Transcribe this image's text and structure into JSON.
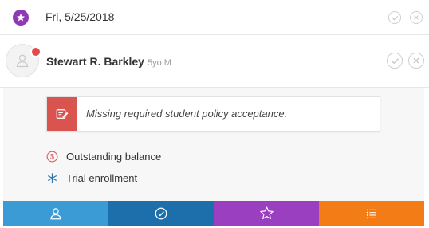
{
  "header": {
    "date": "Fri, 5/25/2018",
    "badge_icon": "star-icon",
    "badge_color": "#8e3ab4"
  },
  "student": {
    "name": "Stewart R. Barkley",
    "age": "5yo M",
    "avatar_icon": "user-icon",
    "status_dot_color": "#e04a4a"
  },
  "alert": {
    "message": "Missing required student policy acceptance.",
    "icon": "edit-document-icon",
    "color": "#d9534f"
  },
  "info_items": [
    {
      "label": "Outstanding balance",
      "icon": "dollar-circle-icon",
      "color": "#e05a5a"
    },
    {
      "label": "Trial enrollment",
      "icon": "asterisk-icon",
      "color": "#2a6faa"
    }
  ],
  "bottom_bar": [
    {
      "icon": "user-icon",
      "color": "#3a9bd5"
    },
    {
      "icon": "check-circle-icon",
      "color": "#1d6fab"
    },
    {
      "icon": "star-icon",
      "color": "#9a3fbf"
    },
    {
      "icon": "list-icon",
      "color": "#f47c16"
    }
  ]
}
